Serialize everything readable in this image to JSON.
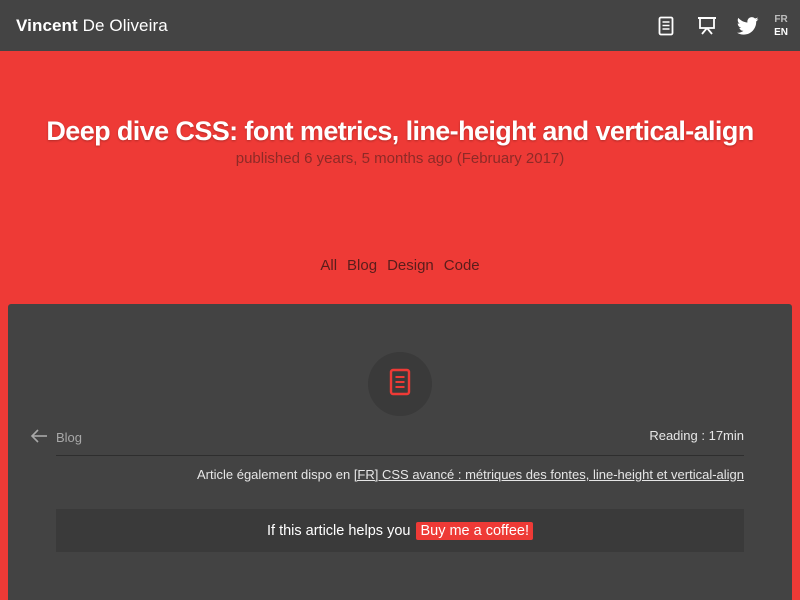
{
  "header": {
    "first_name": "Vincent",
    "last_name": "De Oliveira",
    "icons": [
      "document-icon",
      "presentation-icon",
      "twitter-icon"
    ],
    "lang": {
      "fr": "FR",
      "en": "EN"
    }
  },
  "hero": {
    "title": "Deep dive CSS: font metrics, line-height and vertical-align",
    "subtitle": "published 6 years, 5 months ago (February 2017)"
  },
  "filters": [
    "All",
    "Blog",
    "Design",
    "Code"
  ],
  "article": {
    "back_label": "Blog",
    "reading": "Reading : 17min",
    "also_prefix": "Article également dispo en",
    "also_link": "[FR] CSS avancé : métriques des fontes, line-height et vertical-align",
    "coffee_text": "If this article helps you",
    "coffee_button": "Buy me a coffee!"
  },
  "colors": {
    "accent": "#ee3a36",
    "header_bg": "#444444",
    "card_bg": "#434343"
  }
}
